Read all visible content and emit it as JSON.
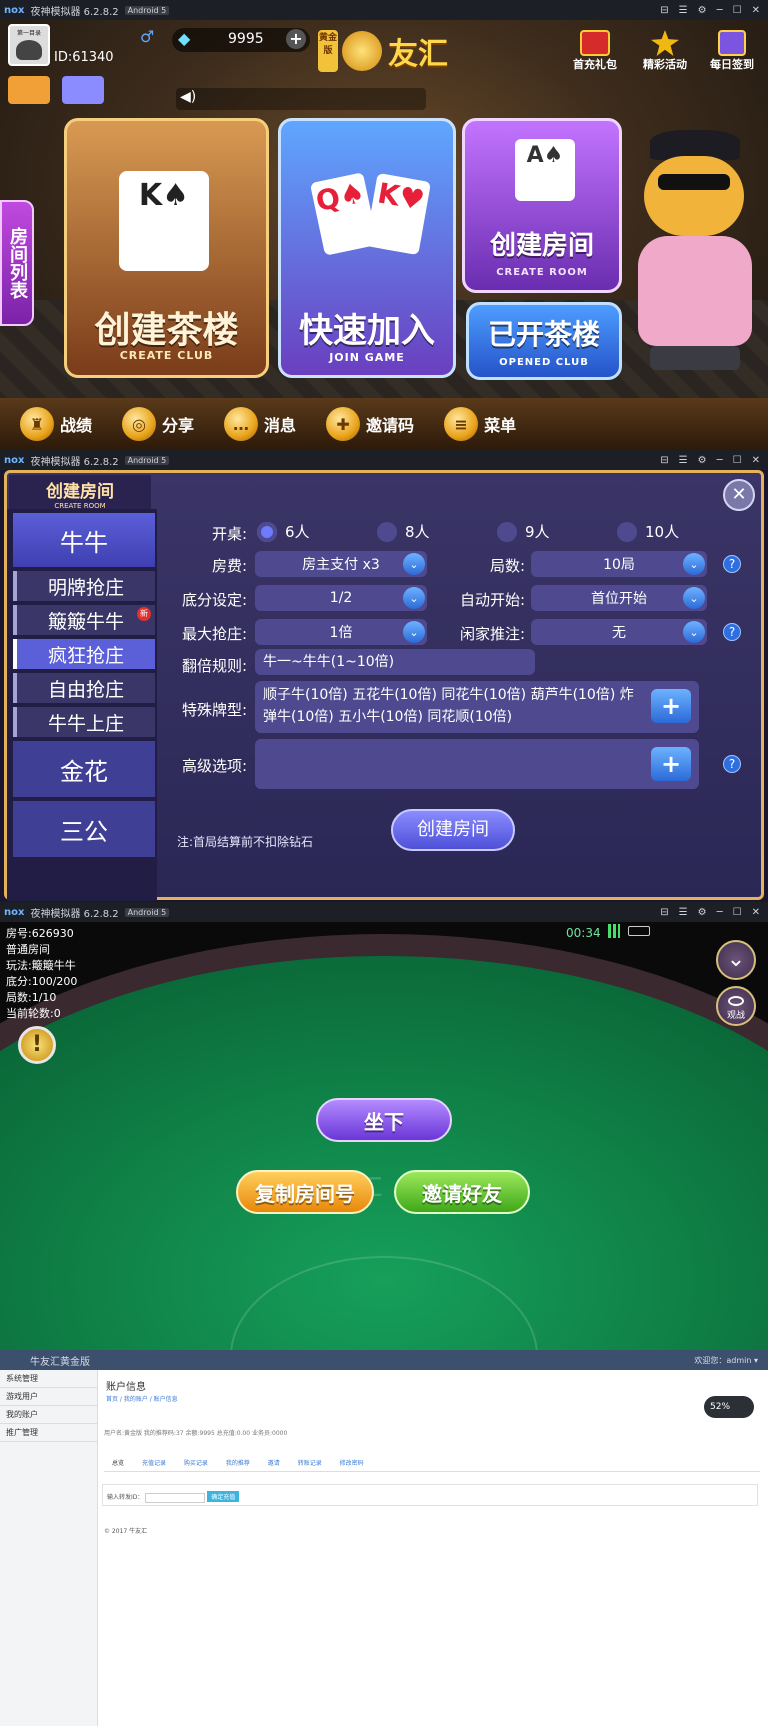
{
  "emulator": {
    "logo": "nox",
    "name": "夜神模拟器 6.2.8.2",
    "android": "Android 5",
    "controls": [
      "⊟",
      "☰",
      "⚙",
      "─",
      "☐",
      "✕"
    ]
  },
  "lobby": {
    "avatar_label": "第一目录",
    "user_id": "ID:61340",
    "gender": "♂",
    "diamonds": "9995",
    "add": "+",
    "level_badge": "黄金版",
    "brand": "友汇",
    "top_icons": [
      "首充礼包",
      "精彩活动",
      "每日签到"
    ],
    "room_list_tab": "房间列表",
    "cards": [
      {
        "title": "创建茶楼",
        "sub": "CREATE CLUB"
      },
      {
        "title": "快速加入",
        "sub": "JOIN GAME"
      },
      {
        "title": "创建房间",
        "sub": "CREATE ROOM"
      },
      {
        "title": "已开茶楼",
        "sub": "OPENED CLUB"
      }
    ],
    "bottom_nav": [
      "战绩",
      "分享",
      "消息",
      "邀请码",
      "菜单"
    ],
    "nav_glyphs": [
      "♜",
      "◎",
      "…",
      "✚",
      "≡"
    ]
  },
  "create_room": {
    "header": "创建房间",
    "header_sub": "CREATE ROOM",
    "close": "✕",
    "sidebar": [
      "牛牛",
      "明牌抢庄",
      "簸簸牛牛",
      "疯狂抢庄",
      "自由抢庄",
      "牛牛上庄",
      "金花",
      "三公"
    ],
    "new_badge": "新",
    "labels": {
      "table": "开桌:",
      "fee": "房费:",
      "rounds": "局数:",
      "base": "底分设定:",
      "auto": "自动开始:",
      "max_bet": "最大抢庄:",
      "push": "闲家推注:",
      "rules": "翻倍规则:",
      "special": "特殊牌型:",
      "advanced": "高级选项:"
    },
    "players": [
      "6人",
      "8人",
      "9人",
      "10人"
    ],
    "fee_value": "房主支付 x3",
    "rounds_value": "10局",
    "base_value": "1/2",
    "auto_value": "首位开始",
    "max_bet_value": "1倍",
    "push_value": "无",
    "rules_value": "牛一~牛牛(1~10倍)",
    "special_value": "顺子牛(10倍) 五花牛(10倍) 同花牛(10倍) 葫芦牛(10倍) 炸弹牛(10倍) 五小牛(10倍) 同花顺(10倍)",
    "help": "?",
    "plus": "+",
    "chev": "⌄",
    "note": "注:首局结算前不扣除钻石",
    "submit": "创建房间"
  },
  "game_room": {
    "time": "00:34",
    "info": [
      "房号:626930",
      "普通房间",
      "玩法:簸簸牛牛",
      "底分:100/200",
      "局数:1/10",
      "当前轮数:0"
    ],
    "alert": "!",
    "watch": "观战",
    "down": "⌄",
    "table_logo": "友汇",
    "sit": "坐下",
    "copy": "复制房间号",
    "invite": "邀请好友"
  },
  "admin": {
    "brand": "牛友汇黄金版",
    "user": "欢迎您：admin ▾",
    "menu": [
      "系统管理",
      "游戏用户",
      "我的账户",
      "推广管理"
    ],
    "page_title": "账户信息",
    "breadcrumb": "首页 / 我的账户 / 账户信息",
    "summary": "用户名:黄金版  我的推荐码:37  余额:9995  总充值:0.00  业务员:0000",
    "tabs": [
      "总览",
      "充值记录",
      "购买记录",
      "我的推荐",
      "邀请",
      "转账记录",
      "修改密码"
    ],
    "input_label": "输入转发ID：",
    "btn": "确定充值",
    "footer": "© 2017 牛友汇",
    "gauge": "52%"
  }
}
